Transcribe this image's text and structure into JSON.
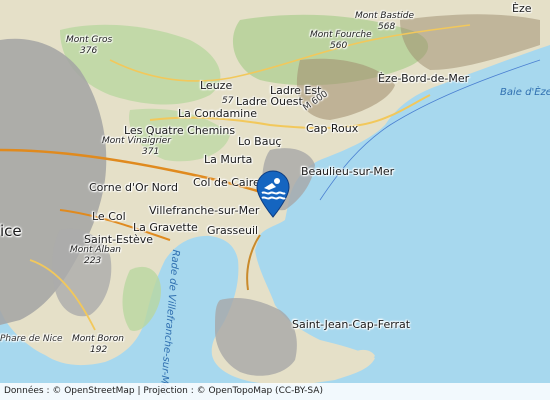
{
  "map": {
    "places": {
      "nice": "ice",
      "eze": "Èze",
      "eze_bord_de_mer": "Èze-Bord-de-Mer",
      "leuze": "Leuze",
      "ladre_est": "Ladre Est",
      "ladre_ouest": "Ladre Ouest",
      "la_condamine": "La Condamine",
      "les_quatre_chemins": "Les Quatre Chemins",
      "cap_roux": "Cap Roux",
      "lo_bauc": "Lo Bauç",
      "la_murta": "La Murta",
      "col_de_caire": "Col de Caire",
      "beaulieu_sur_mer": "Beaulieu-sur-Mer",
      "corne_dor_nord": "Corne d'Or Nord",
      "le_col": "Le Col",
      "villefranche_sur_mer": "Villefranche-sur-Mer",
      "la_gravette": "La Gravette",
      "grasseuil": "Grasseuil",
      "saint_esteve": "Saint-Estève",
      "saint_jean_cap_ferrat": "Saint-Jean-Cap-Ferrat"
    },
    "peaks": {
      "mont_bastide": "Mont Bastide",
      "mont_bastide_ele": "568",
      "mont_fourche": "Mont Fourche",
      "mont_fourche_ele": "560",
      "mont_gros": "Mont Gros",
      "mont_gros_ele": "376",
      "mont_vinaigrier": "Mont Vinaigrier",
      "mont_vinaigrier_ele": "371",
      "mont_alban": "Mont Alban",
      "mont_alban_ele": "223",
      "mont_boron": "Mont Boron",
      "mont_boron_ele": "192",
      "leuze_ele": "57"
    },
    "water": {
      "baie_deze": "Baie d'Èze",
      "rade": "Rade de Villefranche-sur-Mer"
    },
    "roads": {
      "m6007": "M 600",
      "phare": "Phare de Nice"
    },
    "marker_icon": "swimming-icon",
    "colors": {
      "sea": "#a7d8ee",
      "land": "#e6e2cf",
      "urban": "#9c9c9c",
      "marker": "#1565c0"
    }
  },
  "attribution": "Données : © OpenStreetMap | Projection : © OpenTopoMap (CC-BY-SA)"
}
